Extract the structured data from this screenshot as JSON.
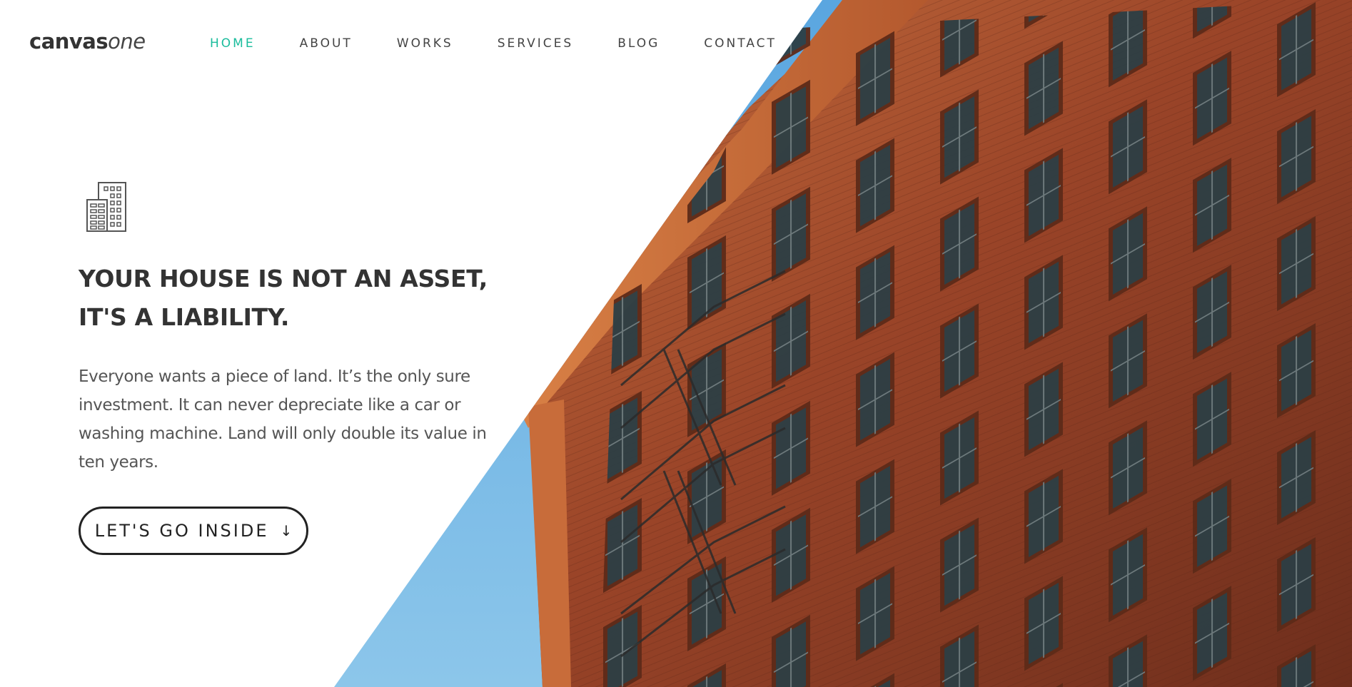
{
  "brand": {
    "logo_bold": "canvas",
    "logo_light": "one"
  },
  "nav": {
    "items": [
      {
        "label": "HOME",
        "active": true
      },
      {
        "label": "ABOUT",
        "active": false
      },
      {
        "label": "WORKS",
        "active": false
      },
      {
        "label": "SERVICES",
        "active": false
      },
      {
        "label": "BLOG",
        "active": false
      },
      {
        "label": "CONTACT",
        "active": false
      }
    ]
  },
  "hero": {
    "icon": "building-icon",
    "headline_line1": "YOUR HOUSE IS NOT AN ASSET,",
    "headline_line2": "IT'S A LIABILITY.",
    "lead": "Everyone wants a piece of land. It’s the only sure investment. It can never depreciate like a car or washing machine. Land will only double its value in ten years.",
    "cta_label": "LET'S GO INSIDE",
    "cta_icon": "arrow-down-icon",
    "image_subject": "brick-building-with-fire-escape"
  },
  "colors": {
    "accent": "#1abc9c",
    "text_dark": "#333333",
    "text_body": "#555555",
    "sky": "#7cb9e0",
    "brick": "#8a3a22"
  }
}
